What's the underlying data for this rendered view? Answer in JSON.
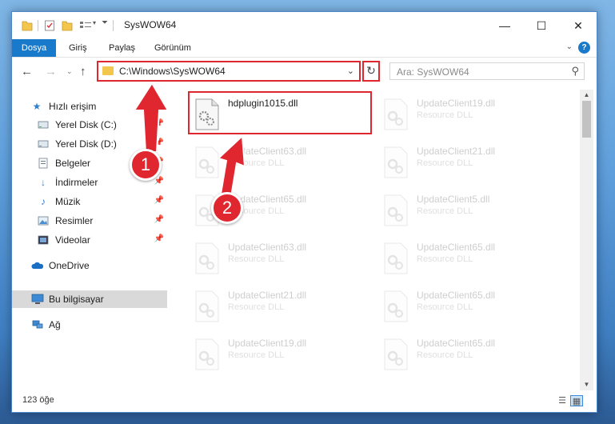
{
  "window": {
    "title": "SysWOW64",
    "controls": {
      "minimize": "—",
      "maximize": "☐",
      "close": "✕"
    }
  },
  "ribbon": {
    "tabs": [
      "Dosya",
      "Giriş",
      "Paylaş",
      "Görünüm"
    ],
    "help": "?"
  },
  "nav": {
    "address": "C:\\Windows\\SysWOW64",
    "search_placeholder": "Ara: SysWOW64"
  },
  "sidebar": {
    "items": [
      {
        "label": "Hızlı erişim",
        "icon": "star-icon"
      },
      {
        "label": "Yerel Disk (C:)",
        "icon": "drive-icon",
        "pinned": true
      },
      {
        "label": "Yerel Disk (D:)",
        "icon": "drive-icon",
        "pinned": true
      },
      {
        "label": "Belgeler",
        "icon": "document-icon",
        "pinned": true
      },
      {
        "label": "İndirmeler",
        "icon": "download-icon",
        "pinned": true
      },
      {
        "label": "Müzik",
        "icon": "music-icon",
        "pinned": true
      },
      {
        "label": "Resimler",
        "icon": "pictures-icon",
        "pinned": true
      },
      {
        "label": "Videolar",
        "icon": "videos-icon",
        "pinned": true
      },
      {
        "label": "OneDrive",
        "icon": "cloud-icon"
      },
      {
        "label": "Bu bilgisayar",
        "icon": "computer-icon",
        "selected": true
      },
      {
        "label": "Ağ",
        "icon": "network-icon"
      }
    ]
  },
  "files": [
    {
      "name": "hdplugin1015.dll",
      "type": "",
      "highlight": true
    },
    {
      "name": "UpdateClient19.dll",
      "type": "Resource DLL"
    },
    {
      "name": "UpdateClient63.dll",
      "type": "Resource DLL"
    },
    {
      "name": "UpdateClient21.dll",
      "type": "Resource DLL"
    },
    {
      "name": "UpdateClient65.dll",
      "type": "Resource DLL"
    },
    {
      "name": "UpdateClient5.dll",
      "type": "Resource DLL"
    },
    {
      "name": "UpdateClient63.dll",
      "type": "Resource DLL"
    },
    {
      "name": "UpdateClient65.dll",
      "type": "Resource DLL"
    },
    {
      "name": "UpdateClient21.dll",
      "type": "Resource DLL"
    },
    {
      "name": "UpdateClient65.dll",
      "type": "Resource DLL"
    },
    {
      "name": "UpdateClient19.dll",
      "type": "Resource DLL"
    },
    {
      "name": "UpdateClient65.dll",
      "type": "Resource DLL"
    }
  ],
  "status": {
    "item_count": "123 öğe"
  },
  "annotations": {
    "step1": "1",
    "step2": "2",
    "color": "#e0262e"
  }
}
